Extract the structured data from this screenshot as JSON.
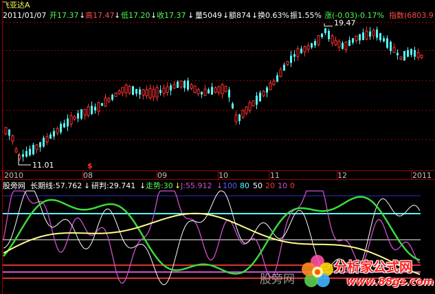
{
  "header": {
    "stock_name": "飞亚达A",
    "date": "2011/01/07",
    "open": "开17.37",
    "high": "高17.47",
    "low": "低17.20",
    "close": "收17.37",
    "volume": "量5049",
    "amount": "额874",
    "turnover": "换0.63%",
    "amplitude": "振1.55%",
    "change": "涨(-0.03)-0.17%",
    "index": "指数(6803.9",
    "arrow_down": "↓"
  },
  "price_chart": {
    "max_label": "19.47",
    "min_label": "11.01",
    "marker": "$",
    "months": [
      "2010",
      "08",
      "09",
      "10",
      "11",
      "12",
      "2011"
    ]
  },
  "indicator": {
    "name": "股旁网",
    "long_label": "长期线:57.762",
    "judge_label": "研判:29.741",
    "trend_label": "走势:30",
    "j_label": "J:55.912",
    "levels": [
      "100",
      "80",
      "50",
      "20",
      "10",
      "0"
    ]
  },
  "watermarks": {
    "left": "股旁网",
    "logo_text": "分析家公式网",
    "logo_url": "www.88gs.com"
  },
  "colors": {
    "up_candle": "#ff3232",
    "down_candle": "#54fcfc",
    "header_red": "#ff4a4a",
    "header_green": "#54fc54",
    "header_yellow": "#ffff54",
    "lightblue_line": "#54fcfc",
    "green_line": "#3cdc3c",
    "yellow_line": "#ffff8c",
    "white_line": "#ffffff",
    "magenta_line": "#d050d0"
  }
}
